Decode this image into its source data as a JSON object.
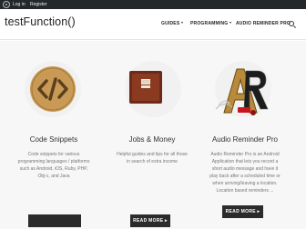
{
  "adminbar": {
    "login": "Log in",
    "register": "Register"
  },
  "header": {
    "site_title": "testFunction()",
    "nav": [
      {
        "label": "GUIDES"
      },
      {
        "label": "PROGRAMMING"
      },
      {
        "label": "AUDIO REMINDER PRO"
      }
    ]
  },
  "features": [
    {
      "title": "Code Snippets",
      "lines": [
        "Code snippets for various",
        "programming languages / platforms",
        "such as Android, iOS, Ruby, PHP,",
        "Obj-c, and Java"
      ],
      "button": ""
    },
    {
      "title": "Jobs & Money",
      "lines": [
        "Helpful guides and tips for all those",
        "in search of extra income"
      ],
      "button": "READ MORE ▸"
    },
    {
      "title": "Audio Reminder Pro",
      "lines": [
        "Audio Reminder Pro is an Android",
        "Application that lets you record a",
        "short audio message and have it",
        "play back after a scheduled time or",
        "when arriving/leaving a location.",
        "Location based reminders ..."
      ],
      "button": "READ MORE ▸"
    }
  ],
  "colors": {
    "adminbar": "#23282d",
    "button": "#2b2b2b",
    "code_icon": "#c89a55"
  }
}
